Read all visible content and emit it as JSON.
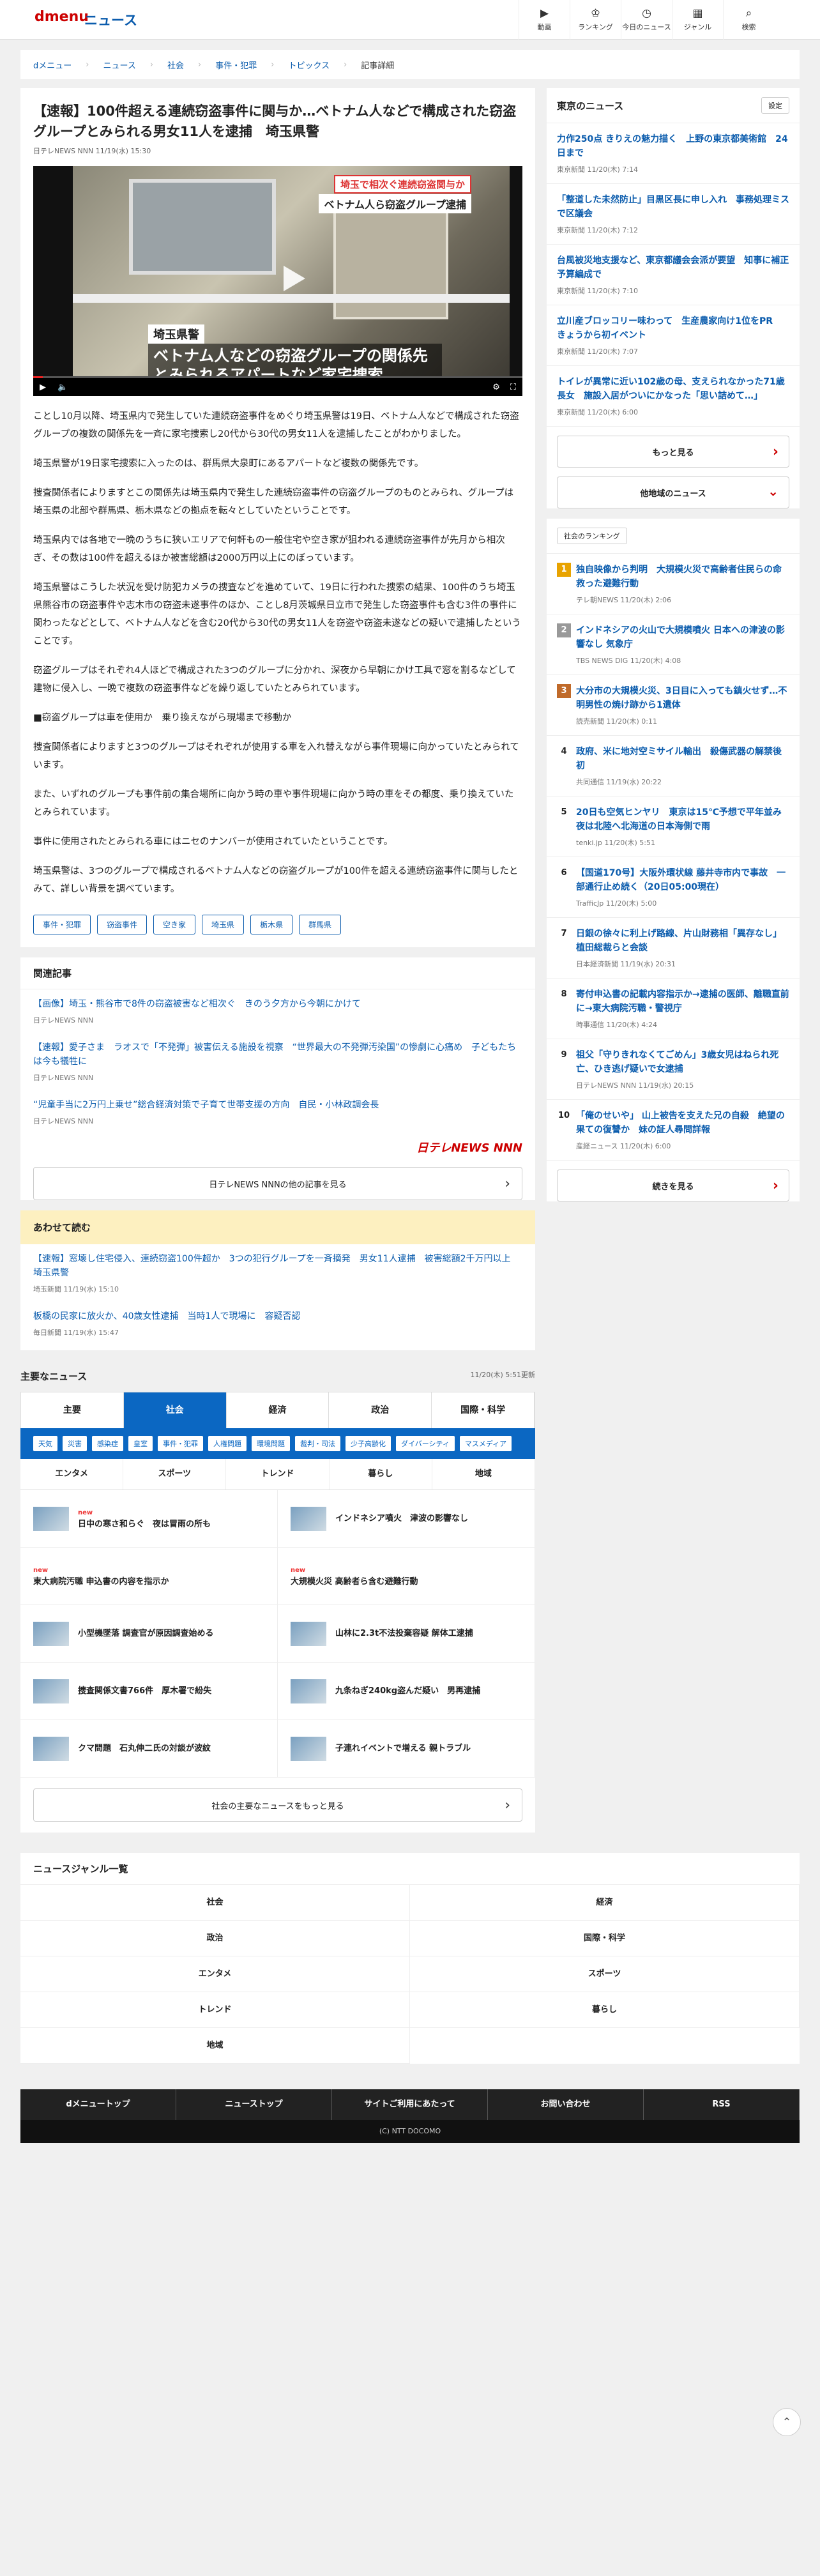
{
  "header": {
    "logo": "dmenu",
    "section": "ニュース",
    "nav": [
      {
        "icon": "▶",
        "label": "動画"
      },
      {
        "icon": "♔",
        "label": "ランキング"
      },
      {
        "icon": "◷",
        "label": "今日のニュース"
      },
      {
        "icon": "▦",
        "label": "ジャンル"
      },
      {
        "icon": "⌕",
        "label": "検索"
      }
    ]
  },
  "breadcrumb": [
    "dメニュー",
    "ニュース",
    "社会",
    "事件・犯罪",
    "トピックス",
    "記事詳細"
  ],
  "article": {
    "title": "【速報】100件超える連続窃盗事件に関与か…ベトナム人などで構成された窃盗グループとみられる男女11人を逮捕　埼玉県警",
    "meta": "日テレNEWS NNN 11/19(水) 15:30",
    "video": {
      "tag1": "埼玉で相次ぐ連続窃盗関与か",
      "tag2": "ベトナム人ら窃盗グループ逮捕",
      "location": "埼玉県警",
      "caption": "ベトナム人などの窃盗グループの関係先とみられるアパートなど家宅捜索",
      "progress": 0.02
    },
    "paragraphs": [
      "ことし10月以降、埼玉県内で発生していた連続窃盗事件をめぐり埼玉県警は19日、ベトナム人などで構成された窃盗グループの複数の関係先を一斉に家宅捜索し20代から30代の男女11人を逮捕したことがわかりました。",
      "埼玉県警が19日家宅捜索に入ったのは、群馬県大泉町にあるアパートなど複数の関係先です。",
      "捜査関係者によりますとこの関係先は埼玉県内で発生した連続窃盗事件の窃盗グループのものとみられ、グループは埼玉県の北部や群馬県、栃木県などの拠点を転々としていたということです。",
      "埼玉県内では各地で一晩のうちに狭いエリアで何軒もの一般住宅や空き家が狙われる連続窃盗事件が先月から相次ぎ、その数は100件を超えるほか被害総額は2000万円以上にのぼっています。",
      "埼玉県警はこうした状況を受け防犯カメラの捜査などを進めていて、19日に行われた捜索の結果、100件のうち埼玉県熊谷市の窃盗事件や志木市の窃盗未遂事件のほか、ことし8月茨城県日立市で発生した窃盗事件も含む3件の事件に関わったなどとして、ベトナム人などを含む20代から30代の男女11人を窃盗や窃盗未遂などの疑いで逮捕したということです。",
      "窃盗グループはそれぞれ4人ほどで構成された3つのグループに分かれ、深夜から早朝にかけ工具で窓を割るなどして建物に侵入し、一晩で複数の窃盗事件などを繰り返していたとみられています。",
      "■窃盗グループは車を使用か　乗り換えながら現場まで移動か",
      "捜査関係者によりますと3つのグループはそれぞれが使用する車を入れ替えながら事件現場に向かっていたとみられています。",
      "また、いずれのグループも事件前の集合場所に向かう時の車や事件現場に向かう時の車をその都度、乗り換えていたとみられています。",
      "事件に使用されたとみられる車にはニセのナンバーが使用されていたということです。",
      "埼玉県警は、3つのグループで構成されるベトナム人などの窃盗グループが100件を超える連続窃盗事件に関与したとみて、詳しい背景を調べています。"
    ],
    "tags": [
      "事件・犯罪",
      "窃盗事件",
      "空き家",
      "埼玉県",
      "栃木県",
      "群馬県"
    ]
  },
  "related": {
    "heading": "関連記事",
    "items": [
      {
        "t": "【画像】埼玉・熊谷市で8件の窃盗被害など相次ぐ　きのう夕方から今朝にかけて",
        "s": "日テレNEWS NNN"
      },
      {
        "t": "【速報】愛子さま　ラオスで「不発弾」被害伝える施設を視察　“世界最大の不発弾汚染国”の惨劇に心痛め　子どもたちは今も犠牲に",
        "s": "日テレNEWS NNN"
      },
      {
        "t": "“児童手当に2万円上乗せ”総合経済対策で子育て世帯支援の方向　自民・小林政調会長",
        "s": "日テレNEWS NNN"
      }
    ],
    "logo": "日テレNEWS NNN",
    "more": "日テレNEWS NNNの他の記事を見る"
  },
  "also": {
    "heading": "あわせて読む",
    "items": [
      {
        "t": "【速報】窓壊し住宅侵入、連続窃盗100件超か　3つの犯行グループを一斉摘発　男女11人逮捕　被害総額2千万円以上　埼玉県警",
        "s": "埼玉新聞 11/19(水) 15:10"
      },
      {
        "t": "板橋の民家に放火か、40歳女性逮捕　当時1人で現場に　容疑否認",
        "s": "毎日新聞 11/19(水) 15:47"
      }
    ]
  },
  "mainnews": {
    "heading": "主要なニュース",
    "time": "11/20(木) 5:51更新",
    "tabs": [
      "主要",
      "社会",
      "経済",
      "政治",
      "国際・科学"
    ],
    "active": 1,
    "subtabs": [
      "天気",
      "災害",
      "感染症",
      "皇室",
      "事件・犯罪",
      "人権問題",
      "環境問題",
      "裁判・司法",
      "少子高齢化",
      "ダイバーシティ",
      "マスメディア"
    ],
    "tabs2": [
      "エンタメ",
      "スポーツ",
      "トレンド",
      "暮らし",
      "地域"
    ],
    "items": [
      {
        "new": "new",
        "t": "日中の寒さ和らぐ　夜は冒雨の所も"
      },
      {
        "new": "",
        "t": "インドネシア噴火　津波の影響なし"
      },
      {
        "new": "new",
        "t": "東大病院汚職 申込書の内容を指示か"
      },
      {
        "new": "new",
        "t": "大規模火災 高齢者ら含む避難行動"
      },
      {
        "new": "",
        "t": "小型機墜落 調査官が原因調査始める"
      },
      {
        "new": "",
        "t": "山林に2.3t不法投棄容疑 解体工逮捕"
      },
      {
        "new": "",
        "t": "捜査関係文書766件　厚木署で紛失"
      },
      {
        "new": "",
        "t": "九条ねぎ240kg盗んだ疑い　男再逮捕"
      },
      {
        "new": "",
        "t": "クマ問題　石丸伸二氏の対談が波紋"
      },
      {
        "new": "",
        "t": "子連れイベントで増える 親トラブル"
      }
    ],
    "more": "社会の主要なニュースをもっと見る"
  },
  "genre": {
    "heading": "ニュースジャンル一覧",
    "items": [
      "社会",
      "経済",
      "政治",
      "国際・科学",
      "エンタメ",
      "スポーツ",
      "トレンド",
      "暮らし",
      "地域"
    ]
  },
  "side": {
    "tokyo": {
      "heading": "東京のニュース",
      "setting": "設定",
      "items": [
        {
          "t": "力作250点 きりえの魅力描く　上野の東京都美術館　24日まで",
          "s": "東京新聞 11/20(木) 7:14"
        },
        {
          "t": "「整道した未然防止」目黒区長に申し入れ　事務処理ミスで区議会",
          "s": "東京新聞 11/20(木) 7:12"
        },
        {
          "t": "台風被災地支援など、東京都議会会派が要望　知事に補正予算編成で",
          "s": "東京新聞 11/20(木) 7:10"
        },
        {
          "t": "立川産ブロッコリー味わって　生産農家向け1位をPR　きょうから初イベント",
          "s": "東京新聞 11/20(木) 7:07"
        },
        {
          "t": "トイレが異常に近い102歳の母、支えられなかった71歳長女　施設入居がついにかなった「思い詰めて…」",
          "s": "東京新聞 11/20(木) 6:00"
        }
      ],
      "more": "もっと見る",
      "other": "他地域のニュース"
    },
    "ranking": {
      "heading": "社会のランキング",
      "items": [
        {
          "n": "1",
          "t": "独自映像から判明　大規模火災で高齢者住民らの命救った避難行動",
          "s": "テレ朝NEWS 11/20(木) 2:06"
        },
        {
          "n": "2",
          "t": "インドネシアの火山で大規模噴火 日本への津波の影響なし 気象庁",
          "s": "TBS NEWS DIG 11/20(木) 4:08"
        },
        {
          "n": "3",
          "t": "大分市の大規模火災、3日目に入っても鎮火せず…不明男性の焼け跡から1遺体",
          "s": "読売新聞 11/20(木) 0:11"
        },
        {
          "n": "4",
          "t": "政府、米に地対空ミサイル輸出　殺傷武器の解禁後初",
          "s": "共同通信 11/19(水) 20:22"
        },
        {
          "n": "5",
          "t": "20日も空気ヒンヤリ　東京は15℃予想で平年並み　夜は北陸へ北海道の日本海側で雨",
          "s": "tenki.jp 11/20(木) 5:51"
        },
        {
          "n": "6",
          "t": "【国道170号】大阪外環状線 藤井寺市内で事故　一部通行止め続く（20日05:00現在）",
          "s": "TrafficJp 11/20(木) 5:00"
        },
        {
          "n": "7",
          "t": "日銀の徐々に利上げ路線、片山財務相「異存なし」　植田総裁らと会談",
          "s": "日本経済新聞 11/19(水) 20:31"
        },
        {
          "n": "8",
          "t": "寄付申込書の記載内容指示か→逮捕の医師、離職直前に→東大病院汚職・警視庁",
          "s": "時事通信 11/20(木) 4:24"
        },
        {
          "n": "9",
          "t": "祖父「守りきれなくてごめん」3歳女児はねられ死亡、ひき逃げ疑いで女逮捕",
          "s": "日テレNEWS NNN 11/19(水) 20:15"
        },
        {
          "n": "10",
          "t": "「俺のせいや」 山上被告を支えた兄の自殺　絶望の果ての復讐か　妹の証人尋問詳報",
          "s": "産経ニュース 11/20(木) 6:00"
        }
      ],
      "more": "続きを見る"
    }
  },
  "footer": {
    "links": [
      "dメニュートップ",
      "ニューストップ",
      "サイトご利用にあたって",
      "お問い合わせ",
      "RSS"
    ],
    "copy": "(C) NTT DOCOMO"
  },
  "colors": {
    "accent": "#0b67c2",
    "link": "#0b5cad",
    "brand": "#cc0000"
  }
}
